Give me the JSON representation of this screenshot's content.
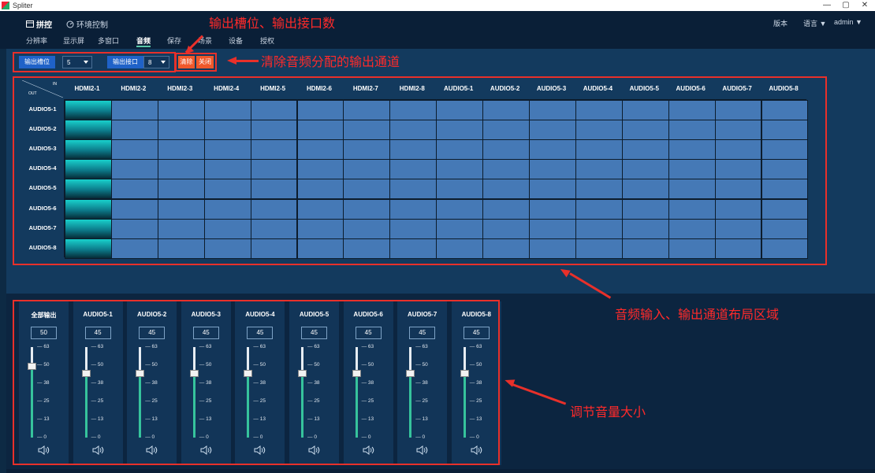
{
  "window": {
    "title": "Spliter",
    "minimize": "—",
    "maximize": "▢",
    "close": "✕"
  },
  "header": {
    "tabs": [
      {
        "label": "拼控"
      },
      {
        "label": "环境控制"
      }
    ],
    "version_label": "版本",
    "language_label": "语言",
    "user_label": "admin"
  },
  "subnav": {
    "items": [
      "分辨率",
      "显示屏",
      "多窗口",
      "音频",
      "保存",
      "场景",
      "设备",
      "授权"
    ],
    "active": "音频"
  },
  "toolbar": {
    "slot_label": "输出槽位",
    "slot_value": "5",
    "port_label": "输出接口",
    "port_value": "8",
    "clear_label": "清除",
    "close_label": "关闭"
  },
  "annotations": {
    "top": "输出槽位、输出接口数",
    "clear": "清除音频分配的输出通道",
    "matrix": "音频输入、输出通道布局区域",
    "volume": "调节音量大小"
  },
  "matrix": {
    "corner_in": "IN",
    "corner_out": "OUT",
    "inputs": [
      "HDMI2-1",
      "HDMI2-2",
      "HDMI2-3",
      "HDMI2-4",
      "HDMI2-5",
      "HDMI2-6",
      "HDMI2-7",
      "HDMI2-8",
      "AUDIO5-1",
      "AUDIO5-2",
      "AUDIO5-3",
      "AUDIO5-4",
      "AUDIO5-5",
      "AUDIO5-6",
      "AUDIO5-7",
      "AUDIO5-8"
    ],
    "outputs": [
      "AUDIO5-1",
      "AUDIO5-2",
      "AUDIO5-3",
      "AUDIO5-4",
      "AUDIO5-5",
      "AUDIO5-6",
      "AUDIO5-7",
      "AUDIO5-8"
    ],
    "selected_input_index": 0,
    "active_color": "#19d0cc",
    "cell_color": "#4579b6"
  },
  "volume": {
    "scale_max": 63,
    "ticks": [
      "63",
      "50",
      "38",
      "25",
      "13",
      "0"
    ],
    "channels": [
      {
        "name": "全部输出",
        "value": 50
      },
      {
        "name": "AUDIO5-1",
        "value": 45
      },
      {
        "name": "AUDIO5-2",
        "value": 45
      },
      {
        "name": "AUDIO5-3",
        "value": 45
      },
      {
        "name": "AUDIO5-4",
        "value": 45
      },
      {
        "name": "AUDIO5-5",
        "value": 45
      },
      {
        "name": "AUDIO5-6",
        "value": 45
      },
      {
        "name": "AUDIO5-7",
        "value": 45
      },
      {
        "name": "AUDIO5-8",
        "value": 45
      }
    ],
    "speaker_icon": "speaker-icon"
  },
  "colors": {
    "accent": "#1f62c8",
    "danger": "#f0582a",
    "annotation": "#e8302a",
    "slider_fill": "#36c39c"
  }
}
